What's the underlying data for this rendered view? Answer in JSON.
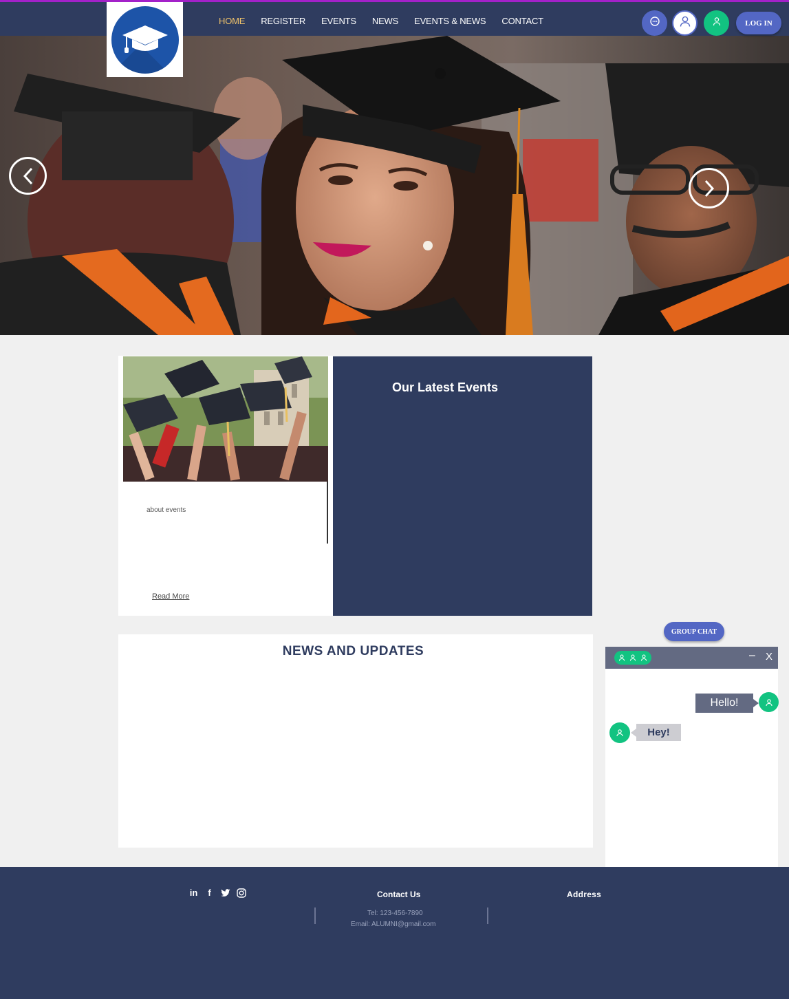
{
  "header": {
    "nav": [
      {
        "label": "HOME",
        "active": true
      },
      {
        "label": "REGISTER",
        "active": false
      },
      {
        "label": "EVENTS",
        "active": false
      },
      {
        "label": "NEWS",
        "active": false
      },
      {
        "label": "EVENTS & NEWS",
        "active": false
      },
      {
        "label": "CONTACT",
        "active": false
      }
    ],
    "login_label": "LOG IN",
    "icons": [
      "chat-icon",
      "user-icon",
      "member-icon"
    ],
    "colors": {
      "bar": "#2f3c5f",
      "accent_line": "#a321c9",
      "active_nav": "#f2c46b",
      "button": "#5367c4",
      "green": "#12c381"
    }
  },
  "hero": {
    "arrows": [
      "chevron-left-icon",
      "chevron-right-icon"
    ]
  },
  "events": {
    "about_text": "about events",
    "read_more": "Read More",
    "latest_title": "Our Latest Events"
  },
  "news": {
    "title": "NEWS AND UPDATES"
  },
  "chat": {
    "group_chat_label": "GROUP CHAT",
    "minimize": "–",
    "close": "X",
    "messages": [
      {
        "text": "Hello!",
        "side": "right"
      },
      {
        "text": "Hey!",
        "side": "left"
      }
    ]
  },
  "footer": {
    "socials": [
      "linkedin-icon",
      "facebook-icon",
      "twitter-icon",
      "instagram-icon"
    ],
    "contact_title": "Contact Us",
    "tel": "Tel: 123-456-7890",
    "email": "Email: ALUMNI@gmail.com",
    "address_title": "Address"
  }
}
